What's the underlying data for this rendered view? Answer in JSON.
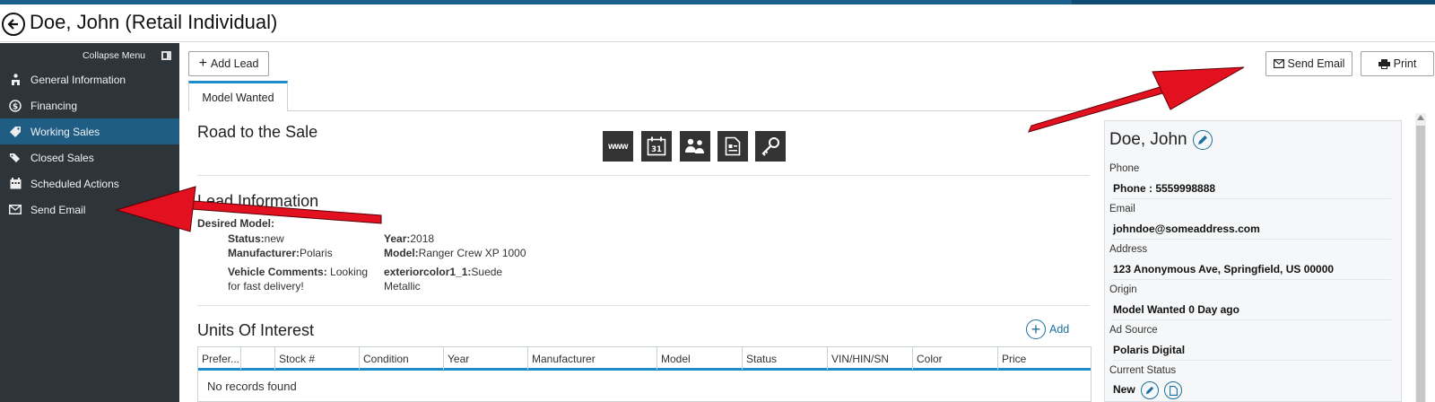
{
  "header": {
    "title": "Doe, John (Retail Individual)"
  },
  "sidebar": {
    "collapse_label": "Collapse Menu",
    "items": [
      {
        "label": "General Information",
        "icon": "person-sitting-icon"
      },
      {
        "label": "Financing",
        "icon": "dollar-circle-icon"
      },
      {
        "label": "Working Sales",
        "icon": "tag-icon",
        "active": true
      },
      {
        "label": "Closed Sales",
        "icon": "tags-icon"
      },
      {
        "label": "Scheduled Actions",
        "icon": "calendar-icon"
      },
      {
        "label": "Send Email",
        "icon": "envelope-icon"
      }
    ]
  },
  "toolbar": {
    "add_lead": "Add Lead",
    "send_email": "Send Email",
    "print": "Print"
  },
  "tabs": [
    {
      "label": "Model Wanted",
      "active": true
    }
  ],
  "road_to_sale": {
    "title": "Road to the Sale",
    "tiles": [
      "www",
      "31"
    ]
  },
  "lead": {
    "title": "Lead Information",
    "desired_model_label": "Desired Model:",
    "status_label": "Status:",
    "status": "new",
    "manufacturer_label": "Manufacturer:",
    "manufacturer": "Polaris",
    "year_label": "Year:",
    "year": "2018",
    "model_label": "Model:",
    "model": "Ranger Crew XP 1000",
    "comments_label": "Vehicle Comments:",
    "comments_line1": "Looking",
    "comments_line2": "for fast delivery!",
    "exterior_label": "exteriorcolor1_1:",
    "exterior_line1": "Suede",
    "exterior_line2": "Metallic"
  },
  "units": {
    "title": "Units Of Interest",
    "add_label": "Add",
    "columns": [
      "Prefer...",
      "",
      "Stock #",
      "Condition",
      "Year",
      "Manufacturer",
      "Model",
      "Status",
      "VIN/HIN/SN",
      "Color",
      "Price"
    ],
    "empty_text": "No records found"
  },
  "contact": {
    "name": "Doe, John",
    "phone_label": "Phone",
    "phone": "Phone : 5559998888",
    "email_label": "Email",
    "email": "johndoe@someaddress.com",
    "address_label": "Address",
    "address": "123 Anonymous Ave, Springfield, US 00000",
    "origin_label": "Origin",
    "origin": "Model Wanted 0 Day ago",
    "ad_source_label": "Ad Source",
    "ad_source": "Polaris Digital",
    "current_status_label": "Current Status",
    "current_status": "New"
  },
  "colors": {
    "sidebar_bg": "#2d353a",
    "active_item": "#1f5d85",
    "accent": "#1b8ec9",
    "arrow": "#e3101f"
  }
}
